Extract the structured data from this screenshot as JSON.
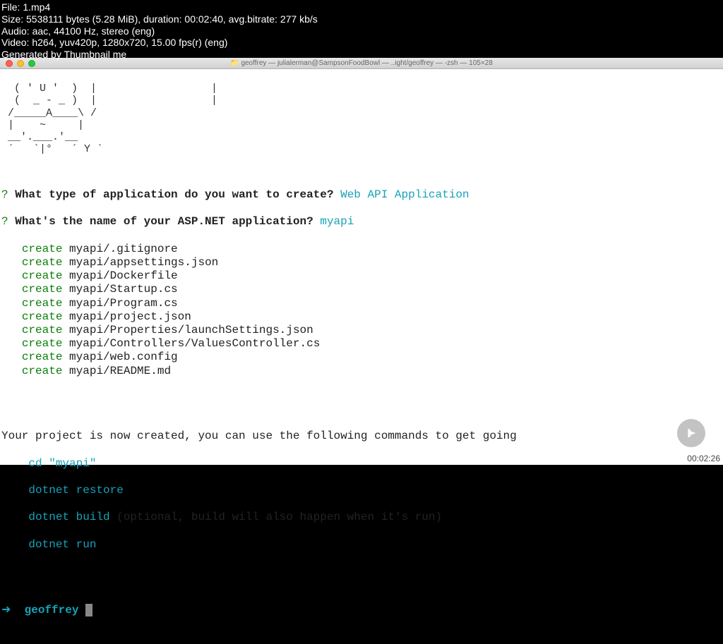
{
  "overlay": {
    "file": "File: 1.mp4",
    "size": "Size: 5538111 bytes (5.28 MiB), duration: 00:02:40, avg.bitrate: 277 kb/s",
    "audio": "Audio: aac, 44100 Hz, stereo (eng)",
    "video": "Video: h264, yuv420p, 1280x720, 15.00 fps(r) (eng)",
    "generated": "Generated by Thumbnail me"
  },
  "titlebar": {
    "title": "geoffrey — julialerman@SampsonFoodBowl — ..ight/geoffrey — -zsh — 105×28"
  },
  "ascii": {
    "l1": "  ( ' U '  )  |                  |",
    "l2": "  (  _ - _ )  |                  |",
    "l3": " /_____A____\\ /",
    "l4": " |    ~     |",
    "l5": " __'.___.'__",
    "l6": " ´   `|°   ´ Y `"
  },
  "prompts": {
    "q1_mark": "?",
    "q1": " What type of application do you want to create? ",
    "a1": "Web API Application",
    "q2_mark": "?",
    "q2": " What's the name of your ASP.NET application? ",
    "a2": "myapi"
  },
  "creates": [
    "myapi/.gitignore",
    "myapi/appsettings.json",
    "myapi/Dockerfile",
    "myapi/Startup.cs",
    "myapi/Program.cs",
    "myapi/project.json",
    "myapi/Properties/launchSettings.json",
    "myapi/Controllers/ValuesController.cs",
    "myapi/web.config",
    "myapi/README.md"
  ],
  "create_label": "create",
  "finished": {
    "msg": "Your project is now created, you can use the following commands to get going",
    "cd": "cd \"myapi\"",
    "restore": "dotnet restore",
    "build": "dotnet build",
    "build_note": " (optional, build will also happen when it's run)",
    "run": "dotnet run"
  },
  "prompt_line": {
    "arrow": "➜  ",
    "dir": "geoffrey"
  },
  "timestamp": "00:02:26"
}
